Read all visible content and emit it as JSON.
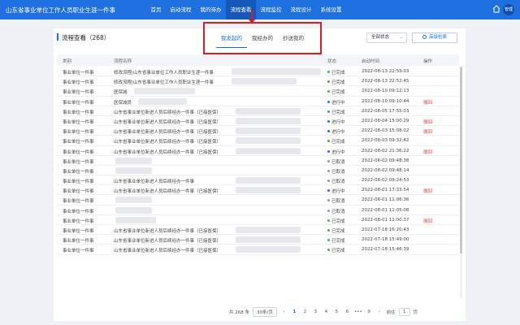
{
  "app": {
    "title": "山东省事业单位工作人员职业生涯一件事",
    "avatar_text": "管理"
  },
  "nav": [
    "首页",
    "启动流程",
    "我的待办",
    "流程查看",
    "流程监控",
    "流程设计",
    "系统设置"
  ],
  "page": {
    "title": "流程查看（268）",
    "tabs": [
      "我发起的",
      "我经办的",
      "抄送我的"
    ],
    "status_filter": "全部状态",
    "advanced_search_label": "高级检索"
  },
  "table": {
    "headers": [
      "类别",
      "流程名称",
      "状态",
      "启动时间",
      "操作"
    ],
    "rows": [
      {
        "type": "事业单位一件事",
        "name": "修改流程|山东省事业单位工作人员职业生涯一件事",
        "status": "已完成",
        "time": "2022-08-13 22:59:03",
        "op": ""
      },
      {
        "type": "事业单位一件事",
        "name": "修改流程|山东省事业单位工作人员职业生涯一件事",
        "status": "已完成",
        "time": "2022-08-13 22:52:45",
        "op": ""
      },
      {
        "type": "事业单位一件事",
        "name": "医保减",
        "status": "已完成",
        "time": "2022-08-10 09:12:13",
        "op": ""
      },
      {
        "type": "事业单位一件事",
        "name": "医保减员",
        "status": "进行中",
        "time": "2022-08-10 09:10:44",
        "op": "撤回"
      },
      {
        "type": "事业单位一件事",
        "name": "山东省事业单位新进人员后续经办一件事（已接医保）",
        "status": "已完成",
        "time": "2022-08-05 17:55:03",
        "op": ""
      },
      {
        "type": "事业单位一件事",
        "name": "山东省事业单位新进人员后续经办一件事（已接医保）",
        "status": "进行中",
        "time": "2022-08-04 15:00:29",
        "op": "撤回"
      },
      {
        "type": "事业单位一件事",
        "name": "山东省事业单位新进人员后续经办一件事（已接医保）",
        "status": "进行中",
        "time": "2022-08-03 15:08:02",
        "op": "撤回"
      },
      {
        "type": "事业单位一件事",
        "name": "山东省事业单位新进人员后续经办一件事（已接医保）",
        "status": "已完成",
        "time": "2022-08-03 09:32:42",
        "op": ""
      },
      {
        "type": "事业单位一件事",
        "name": "山东省事业单位新进人员后续经办一件事（已接医保）",
        "status": "进行中",
        "time": "2022-08-02 21:36:22",
        "op": "撤回"
      },
      {
        "type": "事业单位一件事",
        "name": "",
        "status": "已取消",
        "time": "2022-08-02 09:48:38",
        "op": ""
      },
      {
        "type": "事业单位一件事",
        "name": "",
        "status": "已取消",
        "time": "2022-08-02 09:48:14",
        "op": ""
      },
      {
        "type": "事业单位一件事",
        "name": "山东省事业单位新进人员后续经办一件事",
        "status": "已取消",
        "time": "2022-08-02 09:24:53",
        "op": ""
      },
      {
        "type": "事业单位一件事",
        "name": "山东省事业单位新进人员后续经办一件事（已接医保）",
        "status": "进行中",
        "time": "2022-08-01 17:33:54",
        "op": "撤回"
      },
      {
        "type": "事业单位一件事",
        "name": "",
        "status": "已取消",
        "time": "2022-08-01 11:06:36",
        "op": ""
      },
      {
        "type": "事业单位一件事",
        "name": "",
        "status": "已取消",
        "time": "2022-08-01 11:05:08",
        "op": ""
      },
      {
        "type": "事业单位一件事",
        "name": "",
        "status": "已完成",
        "time": "2022-08-01 11:00:37",
        "op": "撤回"
      },
      {
        "type": "事业单位一件事",
        "name": "山东省事业单位新进人员后续经办一件事（已接医保）",
        "status": "已完成",
        "time": "2022-07-18 16:20:43",
        "op": ""
      },
      {
        "type": "事业单位一件事",
        "name": "山东省事业单位新进人员后续经办一件事（已接医保）",
        "status": "已完成",
        "time": "2022-07-18 15:49:00",
        "op": ""
      },
      {
        "type": "事业单位一件事",
        "name": "山东省事业单位新进人员后续经办一件事（已接医保）",
        "status": "已完成",
        "time": "2022-07-18 15:46:39",
        "op": ""
      }
    ]
  },
  "pagination": {
    "total": "共 268 条",
    "page_size": "30条/页",
    "pages": [
      "1",
      "2",
      "3",
      "4",
      "5",
      "6",
      "•••",
      "9"
    ],
    "jump_label": "前往",
    "jump_value": "1",
    "jump_suffix": "页"
  },
  "colors": {
    "primary": "#1e6fe0",
    "status_done": "#4caf50",
    "status_running": "#1e6fe0",
    "status_cancelled": "#999999",
    "annotation": "#e11a1a"
  }
}
